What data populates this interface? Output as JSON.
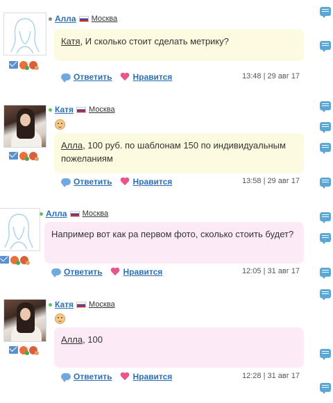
{
  "posts": [
    {
      "author": "Алла",
      "city": "Москва",
      "mention": "Катя",
      "text": ", И сколько стоит сделать метрику?",
      "reply": "Ответить",
      "like": "Нравится",
      "time": "13:48 | 29 авг 17"
    },
    {
      "author": "Катя",
      "city": "Москва",
      "mention": "Алла",
      "text": ", 100 руб. по шаблонам 150 по индивидуальным пожеланиям",
      "reply": "Ответить",
      "like": "Нравится",
      "time": "13:58 | 29 авг 17"
    },
    {
      "author": "Алла",
      "city": "Москва",
      "mention": "",
      "text": "Например вот как ра первом фото, сколько стоить будет?",
      "reply": "Ответить",
      "like": "Нравится",
      "time": "12:05 | 31 авг 17"
    },
    {
      "author": "Катя",
      "city": "Москва",
      "mention": "Алла",
      "text": ", 100",
      "reply": "Ответить",
      "like": "Нравится",
      "time": "12:28 | 31 авг 17"
    }
  ],
  "icons": {
    "online_color": "#5fc25f",
    "offline_color": "#888888",
    "side": "comment-icon"
  }
}
